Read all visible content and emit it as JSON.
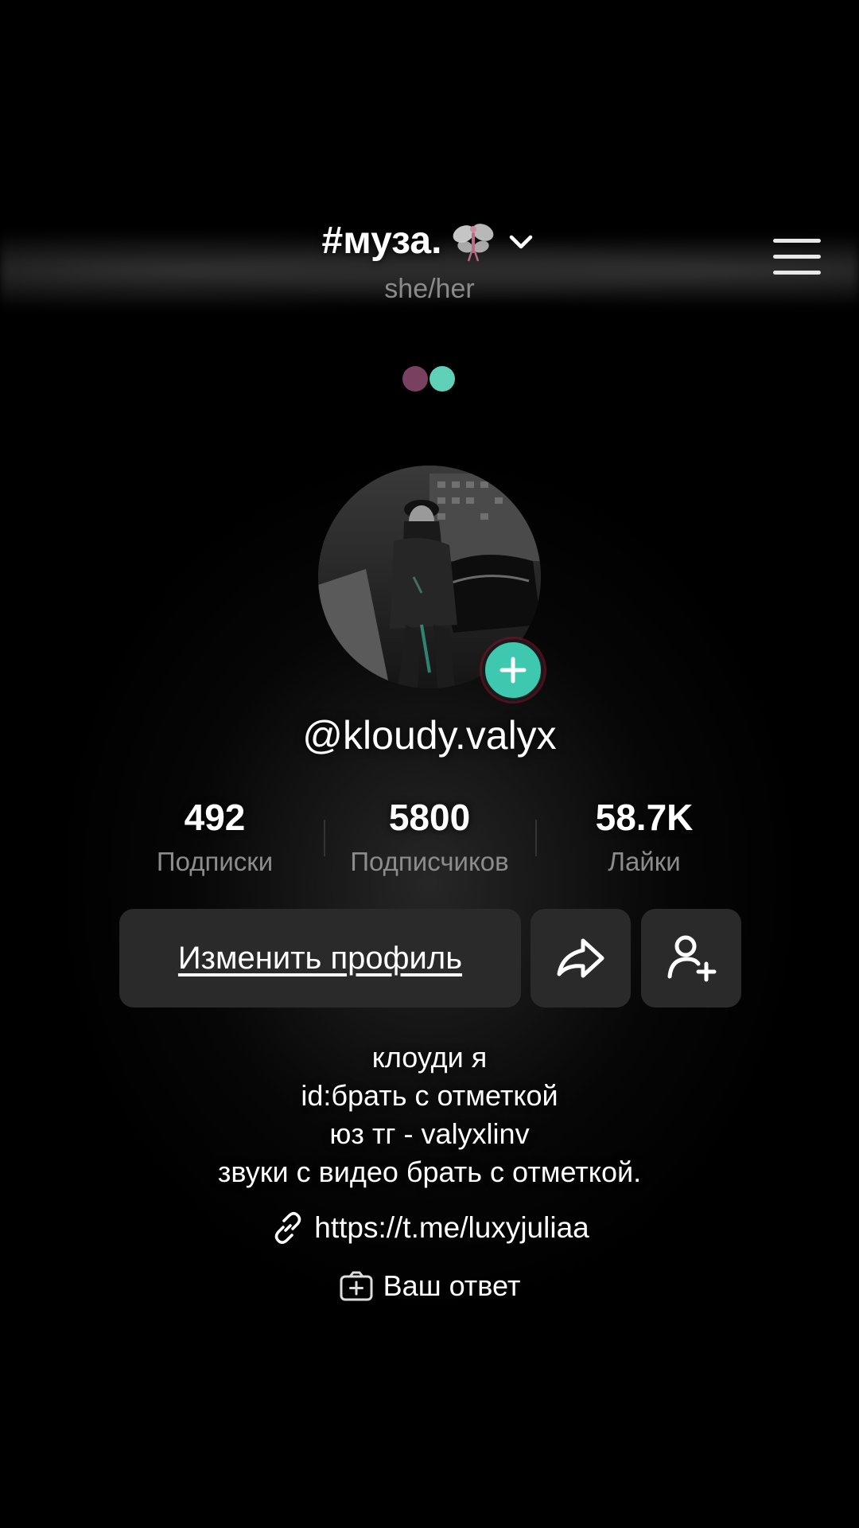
{
  "header": {
    "title": "#муза.",
    "pronouns": "she/her"
  },
  "profile": {
    "handle": "@kloudy.valyx"
  },
  "stats": [
    {
      "value": "492",
      "label": "Подписки"
    },
    {
      "value": "5800",
      "label": "Подписчиков"
    },
    {
      "value": "58.7K",
      "label": "Лайки"
    }
  ],
  "actions": {
    "edit_profile": "Изменить профиль"
  },
  "bio": {
    "line1": "клоуди я",
    "line2": "id:брать с отметкой",
    "line3": "юз тг - valyxlinv",
    "line4": "звуки с видео брать с отметкой."
  },
  "link": {
    "url": "https://t.me/luxyjuliaa"
  },
  "answer": {
    "label": "Ваш ответ"
  },
  "colors": {
    "dot_left": "#7a4060",
    "dot_right": "#5fd1b8",
    "accent_teal": "#3fc8b0",
    "button_bg": "#2a2a2a"
  },
  "icons": [
    "fairy-icon",
    "chevron-down-icon",
    "menu-icon",
    "plus-icon",
    "share-icon",
    "add-friend-icon",
    "link-icon",
    "answer-box-icon"
  ]
}
